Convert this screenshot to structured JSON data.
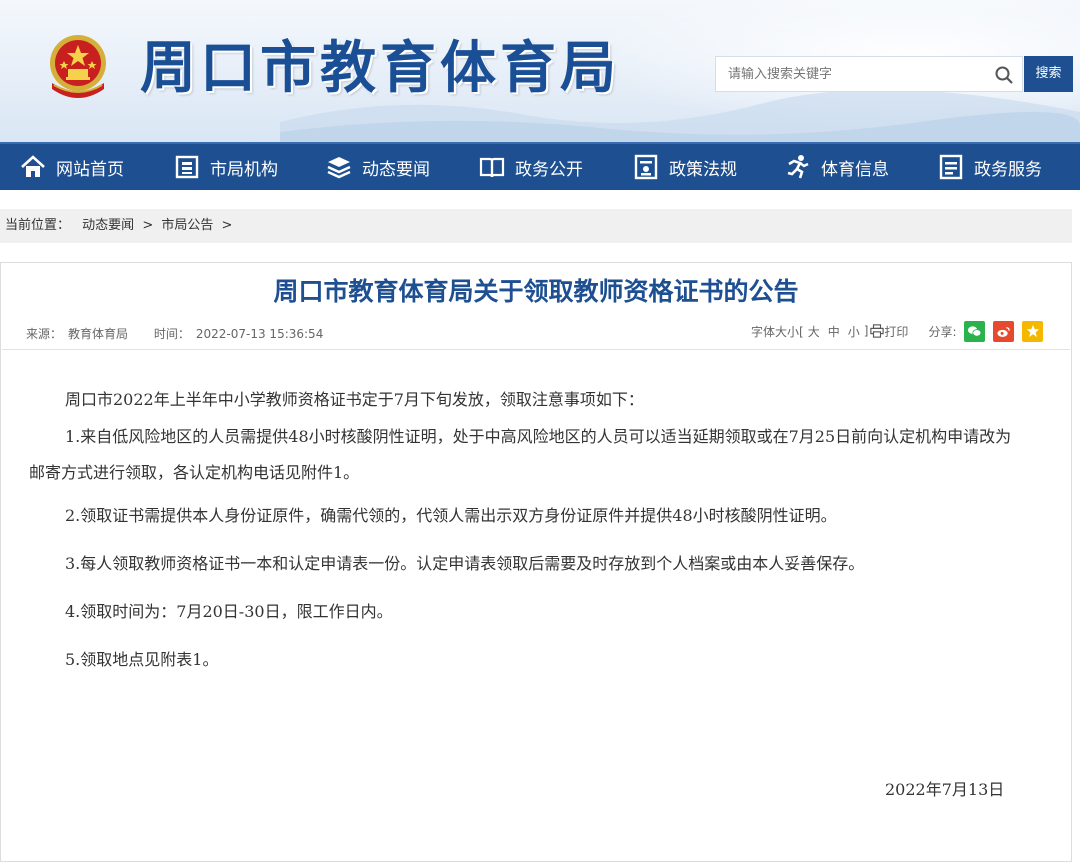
{
  "header": {
    "site_title": "周口市教育体育局",
    "search_placeholder": "请输入搜索关键字",
    "search_button": "搜索"
  },
  "nav": {
    "items": [
      {
        "label": "网站首页",
        "icon": "home-icon"
      },
      {
        "label": "市局机构",
        "icon": "building-icon"
      },
      {
        "label": "动态要闻",
        "icon": "news-stack-icon"
      },
      {
        "label": "政务公开",
        "icon": "open-book-icon"
      },
      {
        "label": "政策法规",
        "icon": "document-icon"
      },
      {
        "label": "体育信息",
        "icon": "runner-icon"
      },
      {
        "label": "政务服务",
        "icon": "list-icon"
      }
    ]
  },
  "breadcrumb": {
    "prefix": "当前位置：",
    "items": [
      "动态要闻",
      "市局公告"
    ],
    "separator": ">"
  },
  "article": {
    "title": "周口市教育体育局关于领取教师资格证书的公告",
    "source_label": "来源：",
    "source": "教育体育局",
    "time_label": "时间：",
    "time": "2022-07-13 15:36:54",
    "font_size_label": "字体大小[",
    "font_sizes": [
      "大",
      "中",
      "小"
    ],
    "font_size_close": "]",
    "print_label": "打印",
    "share_label": "分享:",
    "paragraphs": [
      "周口市2022年上半年中小学教师资格证书定于7月下旬发放，领取注意事项如下：",
      "1.来自低风险地区的人员需提供48小时核酸阴性证明，处于中高风险地区的人员可以适当延期领取或在7月25日前向认定机构申请改为邮寄方式进行领取，各认定机构电话见附件1。",
      "2.领取证书需提供本人身份证原件，确需代领的，代领人需出示双方身份证原件并提供48小时核酸阴性证明。",
      "3.每人领取教师资格证书一本和认定申请表一份。认定申请表领取后需要及时存放到个人档案或由本人妥善保存。",
      "4.领取时间为：7月20日-30日，限工作日内。",
      "5.领取地点见附表1。"
    ],
    "sign_date": "2022年7月13日"
  },
  "colors": {
    "brand": "#1d4f91",
    "wechat": "#2bb24c",
    "weibo": "#e6492d",
    "qzone": "#f5b800"
  }
}
